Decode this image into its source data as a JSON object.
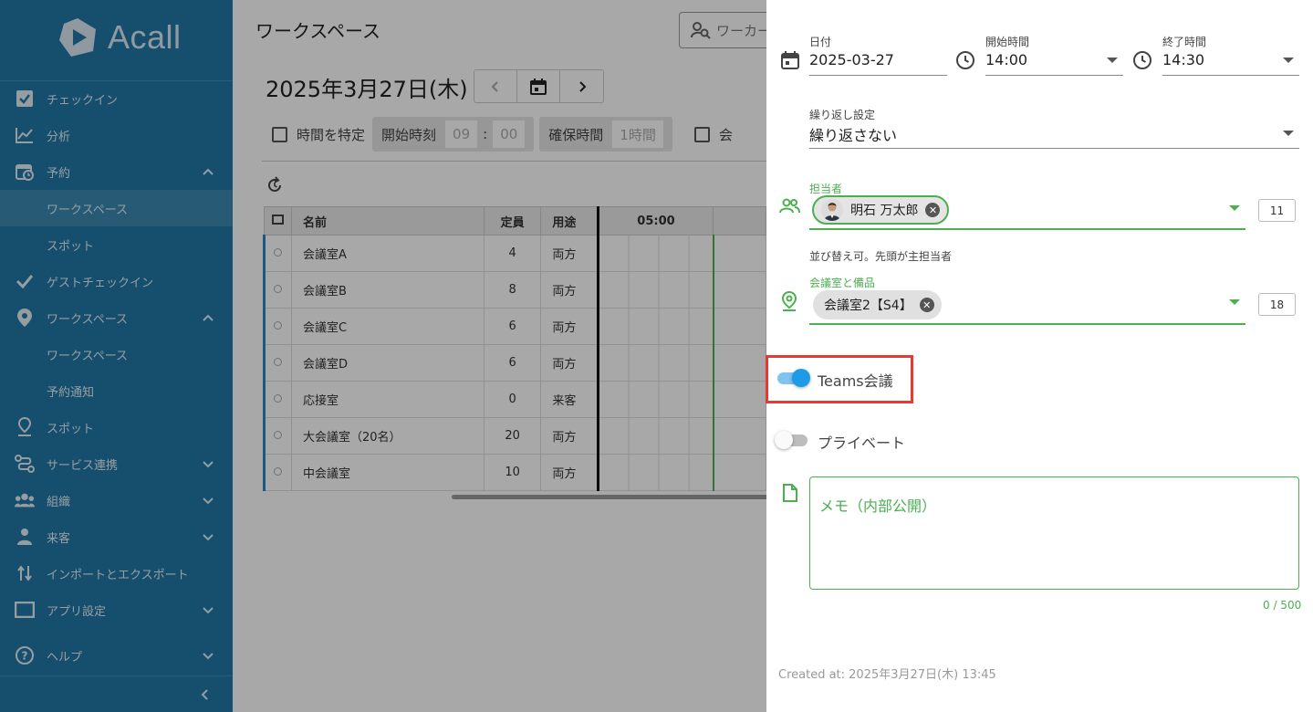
{
  "app": {
    "logo_text": "Acall",
    "brand_color": "#2279a8"
  },
  "sidebar": {
    "items": [
      {
        "label": "チェックイン",
        "icon": "checkbox-icon"
      },
      {
        "label": "分析",
        "icon": "chart-line-icon"
      },
      {
        "label": "予約",
        "icon": "calendar-clock-icon",
        "expanded": true
      },
      {
        "label": "ワークスペース",
        "sub": true,
        "active": true
      },
      {
        "label": "スポット",
        "sub": true
      },
      {
        "label": "ゲストチェックイン",
        "icon": "check-icon"
      },
      {
        "label": "ワークスペース",
        "icon": "location-pin-icon",
        "expanded": true
      },
      {
        "label": "ワークスペース",
        "sub": true
      },
      {
        "label": "予約通知",
        "sub": true
      },
      {
        "label": "スポット",
        "icon": "spot-pin-icon"
      },
      {
        "label": "サービス連携",
        "icon": "integration-icon",
        "collapsed": true
      },
      {
        "label": "組織",
        "icon": "people-icon",
        "collapsed": true
      },
      {
        "label": "来客",
        "icon": "visitor-icon",
        "collapsed": true
      },
      {
        "label": "インポートとエクスポート",
        "icon": "import-export-icon"
      },
      {
        "label": "アプリ設定",
        "icon": "app-window-icon",
        "collapsed": true
      },
      {
        "label": "ヘルプ",
        "icon": "help-icon",
        "collapsed": true
      }
    ],
    "collapse_label": "<"
  },
  "main": {
    "title": "ワークスペース",
    "search_placeholder": "ワーカー",
    "date": "2025年3月27日(木)",
    "filters": {
      "specify_time_label": "時間を特定",
      "start_time_label": "開始時刻",
      "start_hour": "09",
      "colon": ":",
      "start_minute": "00",
      "duration_label": "確保時間",
      "duration_value": "1時間",
      "meeting_label": "会"
    },
    "table": {
      "headers": {
        "name": "名前",
        "capacity": "定員",
        "usage": "用途",
        "time": "05:00"
      },
      "rows": [
        {
          "name": "会議室A",
          "capacity": "4",
          "usage": "両方"
        },
        {
          "name": "会議室B",
          "capacity": "8",
          "usage": "両方"
        },
        {
          "name": "会議室C",
          "capacity": "6",
          "usage": "両方"
        },
        {
          "name": "会議室D",
          "capacity": "6",
          "usage": "両方"
        },
        {
          "name": "応接室",
          "capacity": "0",
          "usage": "来客"
        },
        {
          "name": "大会議室（20名）",
          "capacity": "20",
          "usage": "両方"
        },
        {
          "name": "中会議室",
          "capacity": "10",
          "usage": "両方"
        }
      ]
    }
  },
  "panel": {
    "date_label": "日付",
    "date_value": "2025-03-27",
    "start_label": "開始時間",
    "start_value": "14:00",
    "end_label": "終了時間",
    "end_value": "14:30",
    "repeat_label": "繰り返し設定",
    "repeat_value": "繰り返さない",
    "owner_label": "担当者",
    "owner_chip": "明石 万太郎",
    "owner_count": "11",
    "reorder_hint": "並び替え可。先頭が主担当者",
    "room_label": "会議室と備品",
    "room_chip": "会議室2【S4】",
    "room_count": "18",
    "teams_label": "Teams会議",
    "teams_on": true,
    "private_label": "プライベート",
    "private_on": false,
    "memo_placeholder": "メモ（内部公開）",
    "memo_counter": "0 / 500",
    "created_at": "Created at: 2025年3月27日(木) 13:45",
    "accent_green": "#4caf50",
    "highlight_color": "#e53935"
  }
}
